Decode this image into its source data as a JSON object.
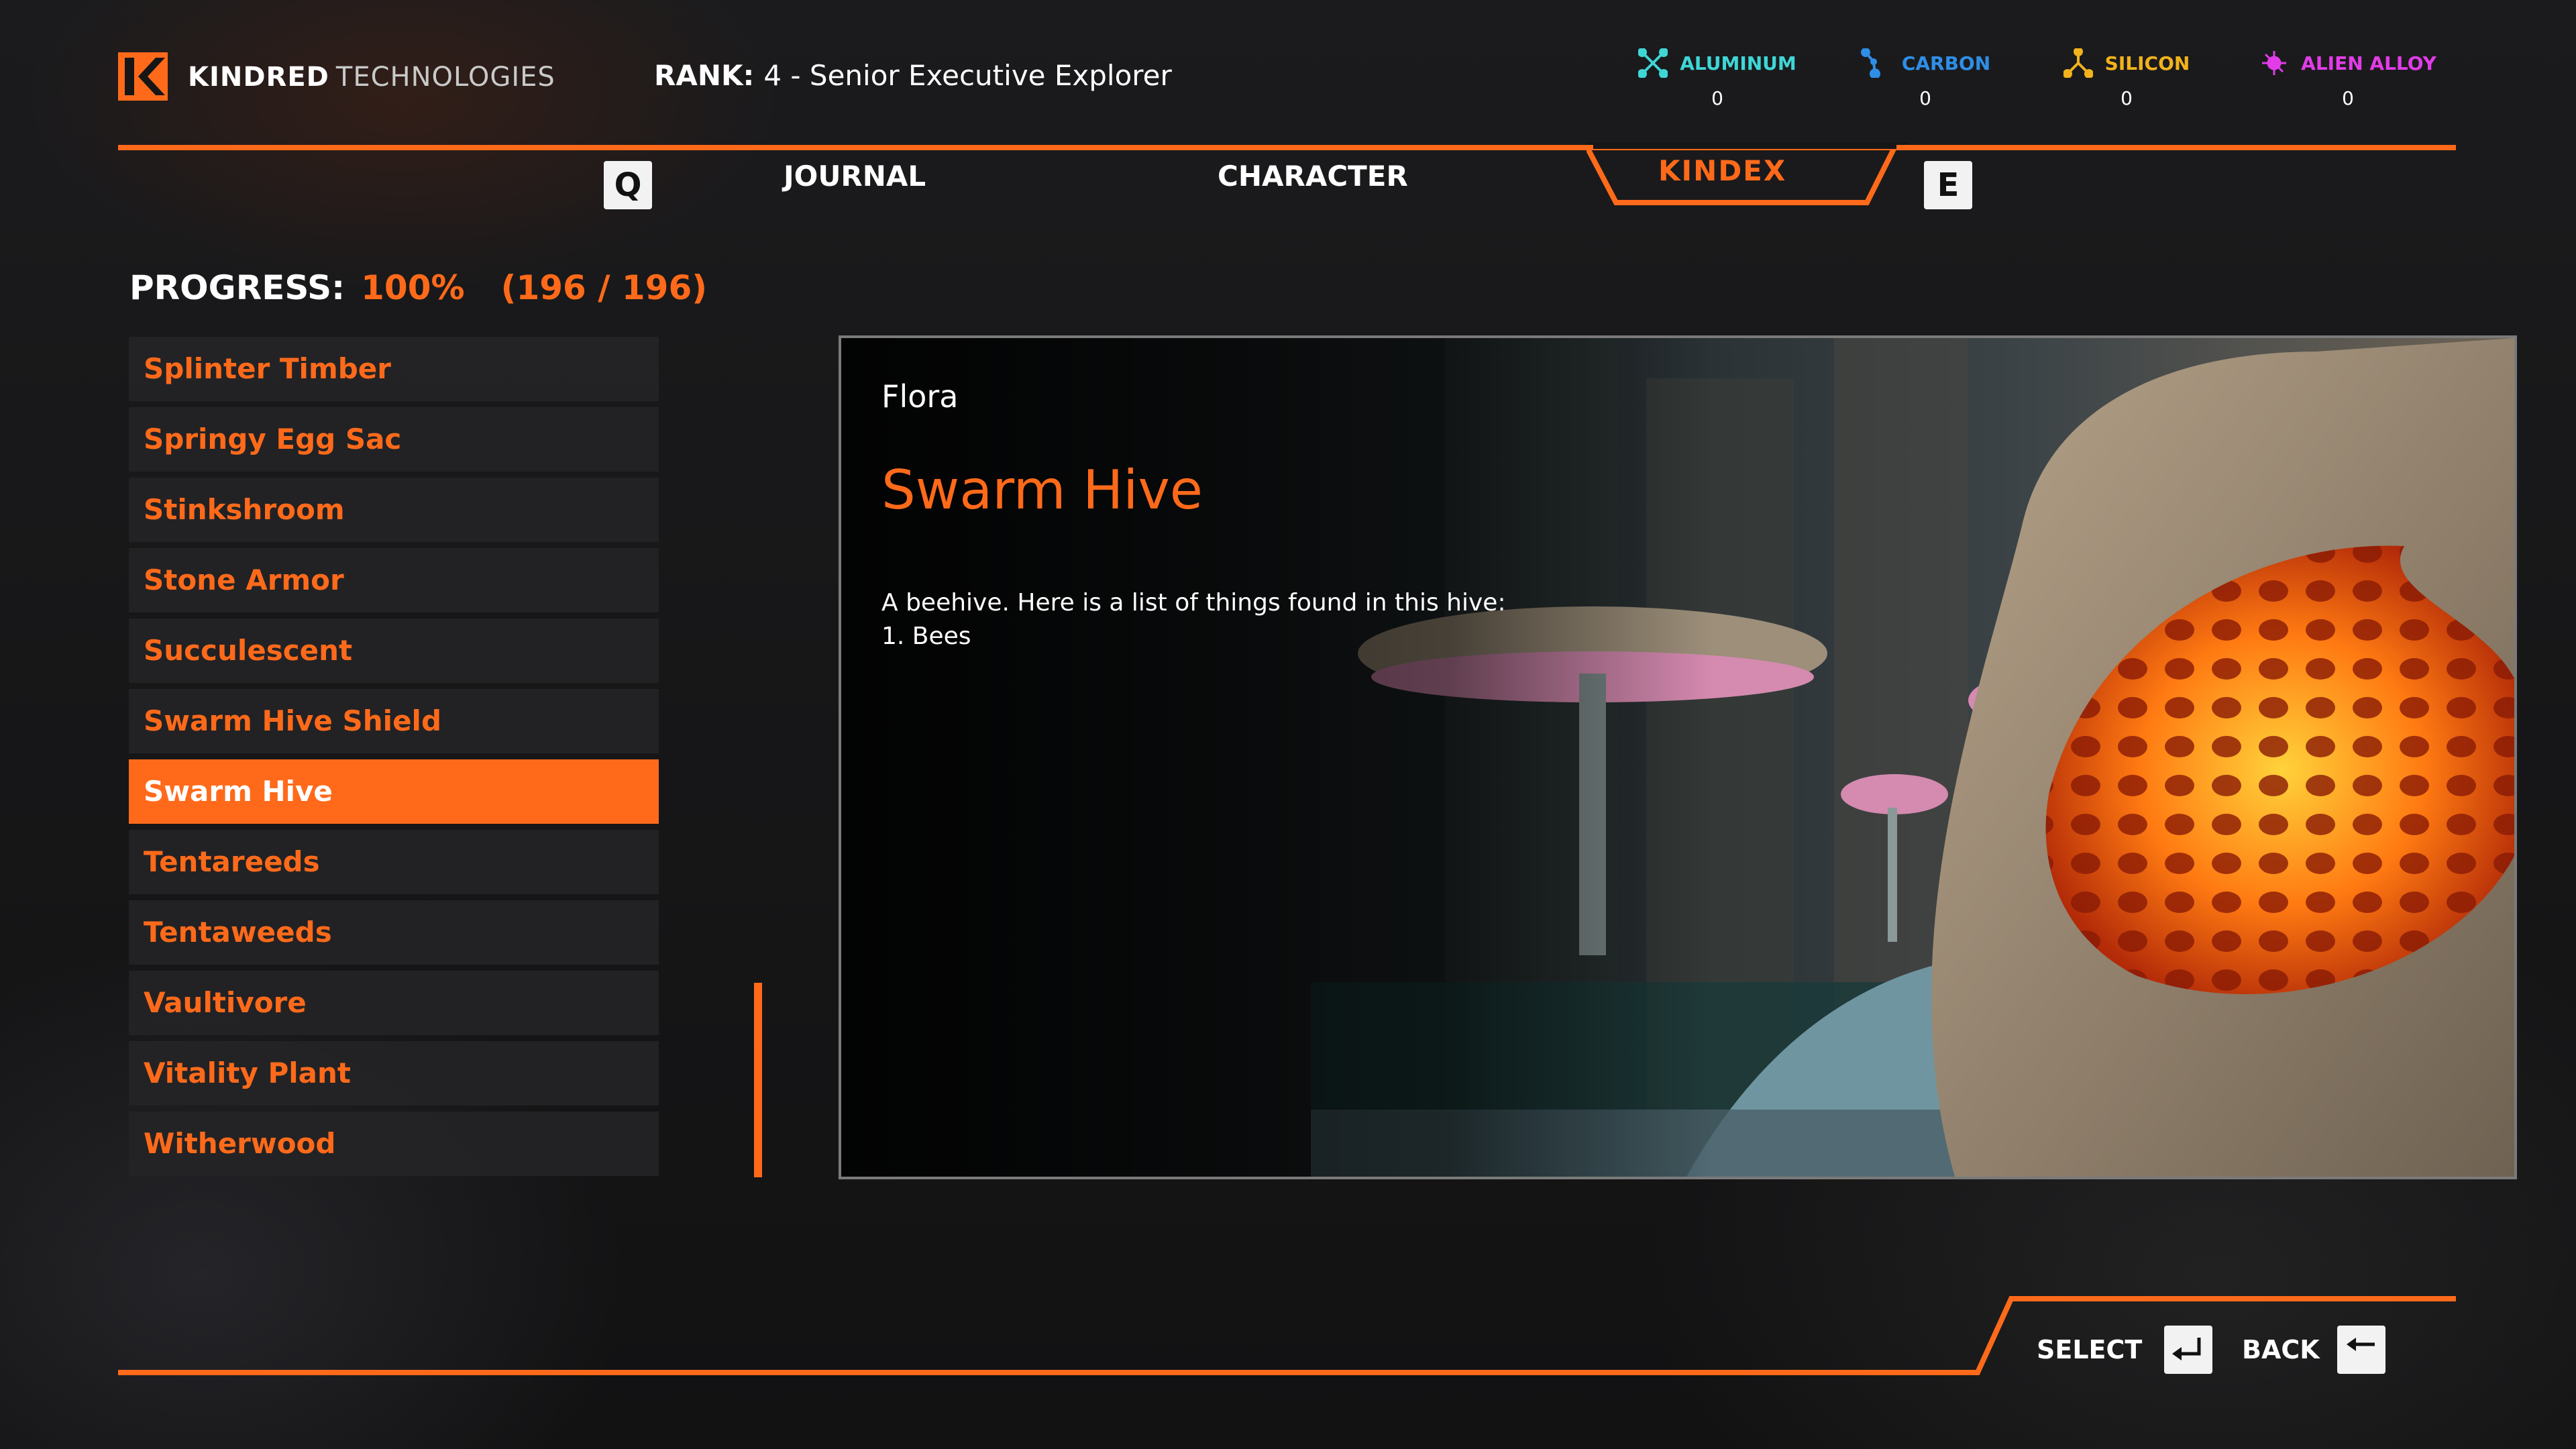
{
  "header": {
    "brand_primary": "KINDRED",
    "brand_secondary": "TECHNOLOGIES",
    "rank_label": "RANK:",
    "rank_value": "4 - Senior Executive Explorer"
  },
  "resources": [
    {
      "name": "ALUMINUM",
      "value": "0",
      "color": "#3fd6d6",
      "icon": "aluminum-molecule-icon"
    },
    {
      "name": "CARBON",
      "value": "0",
      "color": "#2f8ee6",
      "icon": "carbon-molecule-icon"
    },
    {
      "name": "SILICON",
      "value": "0",
      "color": "#f2b21c",
      "icon": "silicon-molecule-icon"
    },
    {
      "name": "ALIEN ALLOY",
      "value": "0",
      "color": "#e23ce8",
      "icon": "alien-alloy-molecule-icon"
    }
  ],
  "tabs": {
    "prev_key": "Q",
    "next_key": "E",
    "items": [
      {
        "label": "JOURNAL"
      },
      {
        "label": "CHARACTER"
      },
      {
        "label": "KINDEX",
        "active": true
      }
    ]
  },
  "progress": {
    "label": "PROGRESS:",
    "percent": "100%",
    "count": "(196 / 196)"
  },
  "list": {
    "items": [
      {
        "label": "Splinter Timber"
      },
      {
        "label": "Springy Egg Sac"
      },
      {
        "label": "Stinkshroom"
      },
      {
        "label": "Stone Armor"
      },
      {
        "label": "Succulescent"
      },
      {
        "label": "Swarm Hive Shield"
      },
      {
        "label": "Swarm Hive",
        "selected": true
      },
      {
        "label": "Tentareeds"
      },
      {
        "label": "Tentaweeds"
      },
      {
        "label": "Vaultivore"
      },
      {
        "label": "Vitality Plant"
      },
      {
        "label": "Witherwood"
      }
    ]
  },
  "detail": {
    "category": "Flora",
    "title": "Swarm Hive",
    "description_lines": [
      "A beehive. Here is a list of things found in this hive:",
      "1. Bees"
    ]
  },
  "footer": {
    "select_label": "SELECT",
    "back_label": "BACK"
  },
  "colors": {
    "accent": "#ff6a1a",
    "panel_border": "#7a7a7a"
  }
}
